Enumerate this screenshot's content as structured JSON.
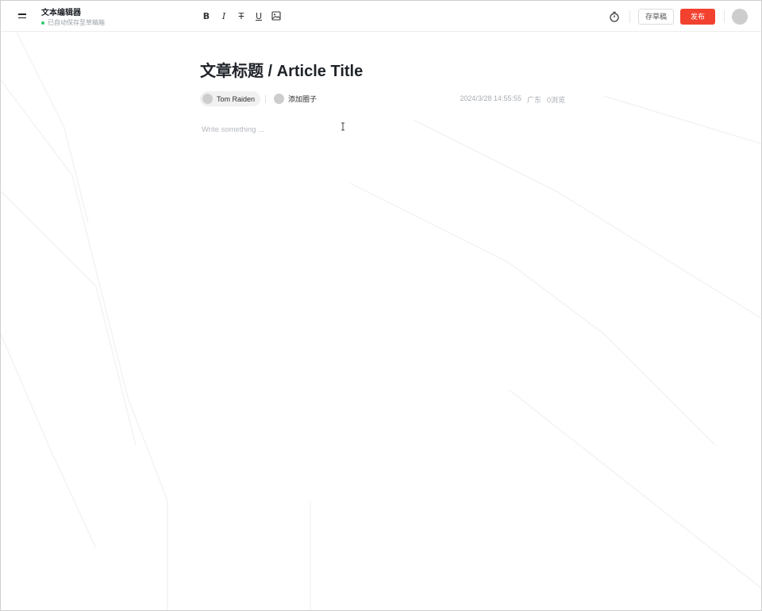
{
  "app": {
    "doc_title": "文本编辑器",
    "save_status": "已自动保存至草稿箱",
    "save_status_color": "#2ecc71"
  },
  "toolbar": {
    "tools": [
      {
        "name": "bold",
        "glyph": "B"
      },
      {
        "name": "italic",
        "glyph": "I"
      },
      {
        "name": "strikethrough",
        "glyph": "T"
      },
      {
        "name": "underline",
        "glyph": "U"
      },
      {
        "name": "image",
        "glyph": "image-icon"
      }
    ]
  },
  "actions": {
    "timer_icon": "timer-icon",
    "draft_label": "存草稿",
    "publish_label": "发布",
    "publish_color": "#f2422f"
  },
  "article": {
    "title": "文章标题 / Article Title",
    "author": "Tom Raiden",
    "circle_label": "添加圈子",
    "datetime": "2024/3/28 14:55:55",
    "location": "广东",
    "views": "0浏览",
    "placeholder": "Write something ..."
  }
}
